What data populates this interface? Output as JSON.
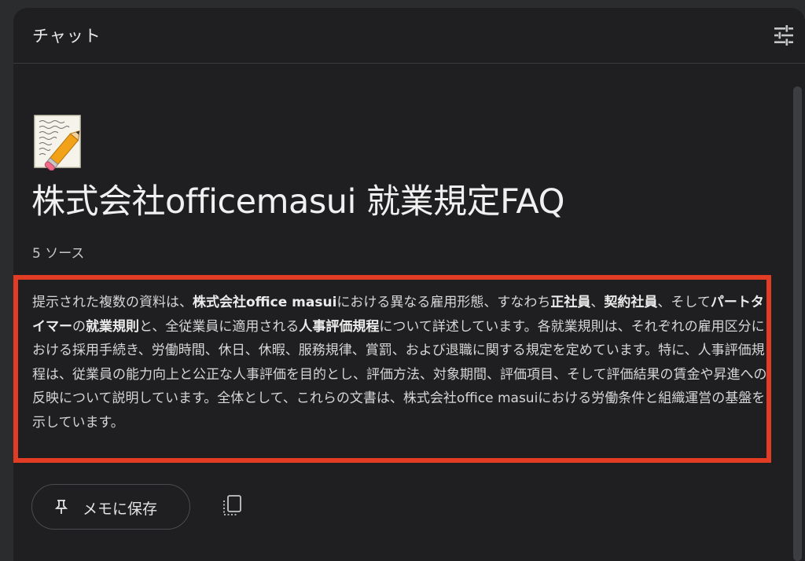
{
  "header": {
    "title": "チャット",
    "tune_icon": "tune-icon"
  },
  "notebook": {
    "emoji": "memo-pencil-icon",
    "title": "株式会社officemasui 就業規定FAQ",
    "source_count": "5 ソース"
  },
  "summary": {
    "segments": [
      {
        "text": "提示された複数の資料は、",
        "bold": false
      },
      {
        "text": "株式会社office masui",
        "bold": true
      },
      {
        "text": "における異なる雇用形態、すなわち",
        "bold": false
      },
      {
        "text": "正社員",
        "bold": true
      },
      {
        "text": "、",
        "bold": false
      },
      {
        "text": "契約社員",
        "bold": true
      },
      {
        "text": "、そして",
        "bold": false
      },
      {
        "text": "パートタイマー",
        "bold": true
      },
      {
        "text": "の",
        "bold": false
      },
      {
        "text": "就業規則",
        "bold": true
      },
      {
        "text": "と、全従業員に適用される",
        "bold": false
      },
      {
        "text": "人事評価規程",
        "bold": true
      },
      {
        "text": "について詳述しています。各就業規則は、それぞれの雇用区分における採用手続き、労働時間、休日、休暇、服務規律、賞罰、および退職に関する規定を定めています。特に、人事評価規程は、従業員の能力向上と公正な人事評価を目的とし、評価方法、対象期間、評価項目、そして評価結果の賃金や昇進への反映について説明しています。全体として、これらの文書は、株式会社office masuiにおける労働条件と組織運営の基盤を示しています。",
        "bold": false
      }
    ],
    "highlight_color": "#e23c25"
  },
  "actions": {
    "save_label": "メモに保存",
    "pin_icon": "pin-icon",
    "copy_icon": "copy-icon"
  }
}
